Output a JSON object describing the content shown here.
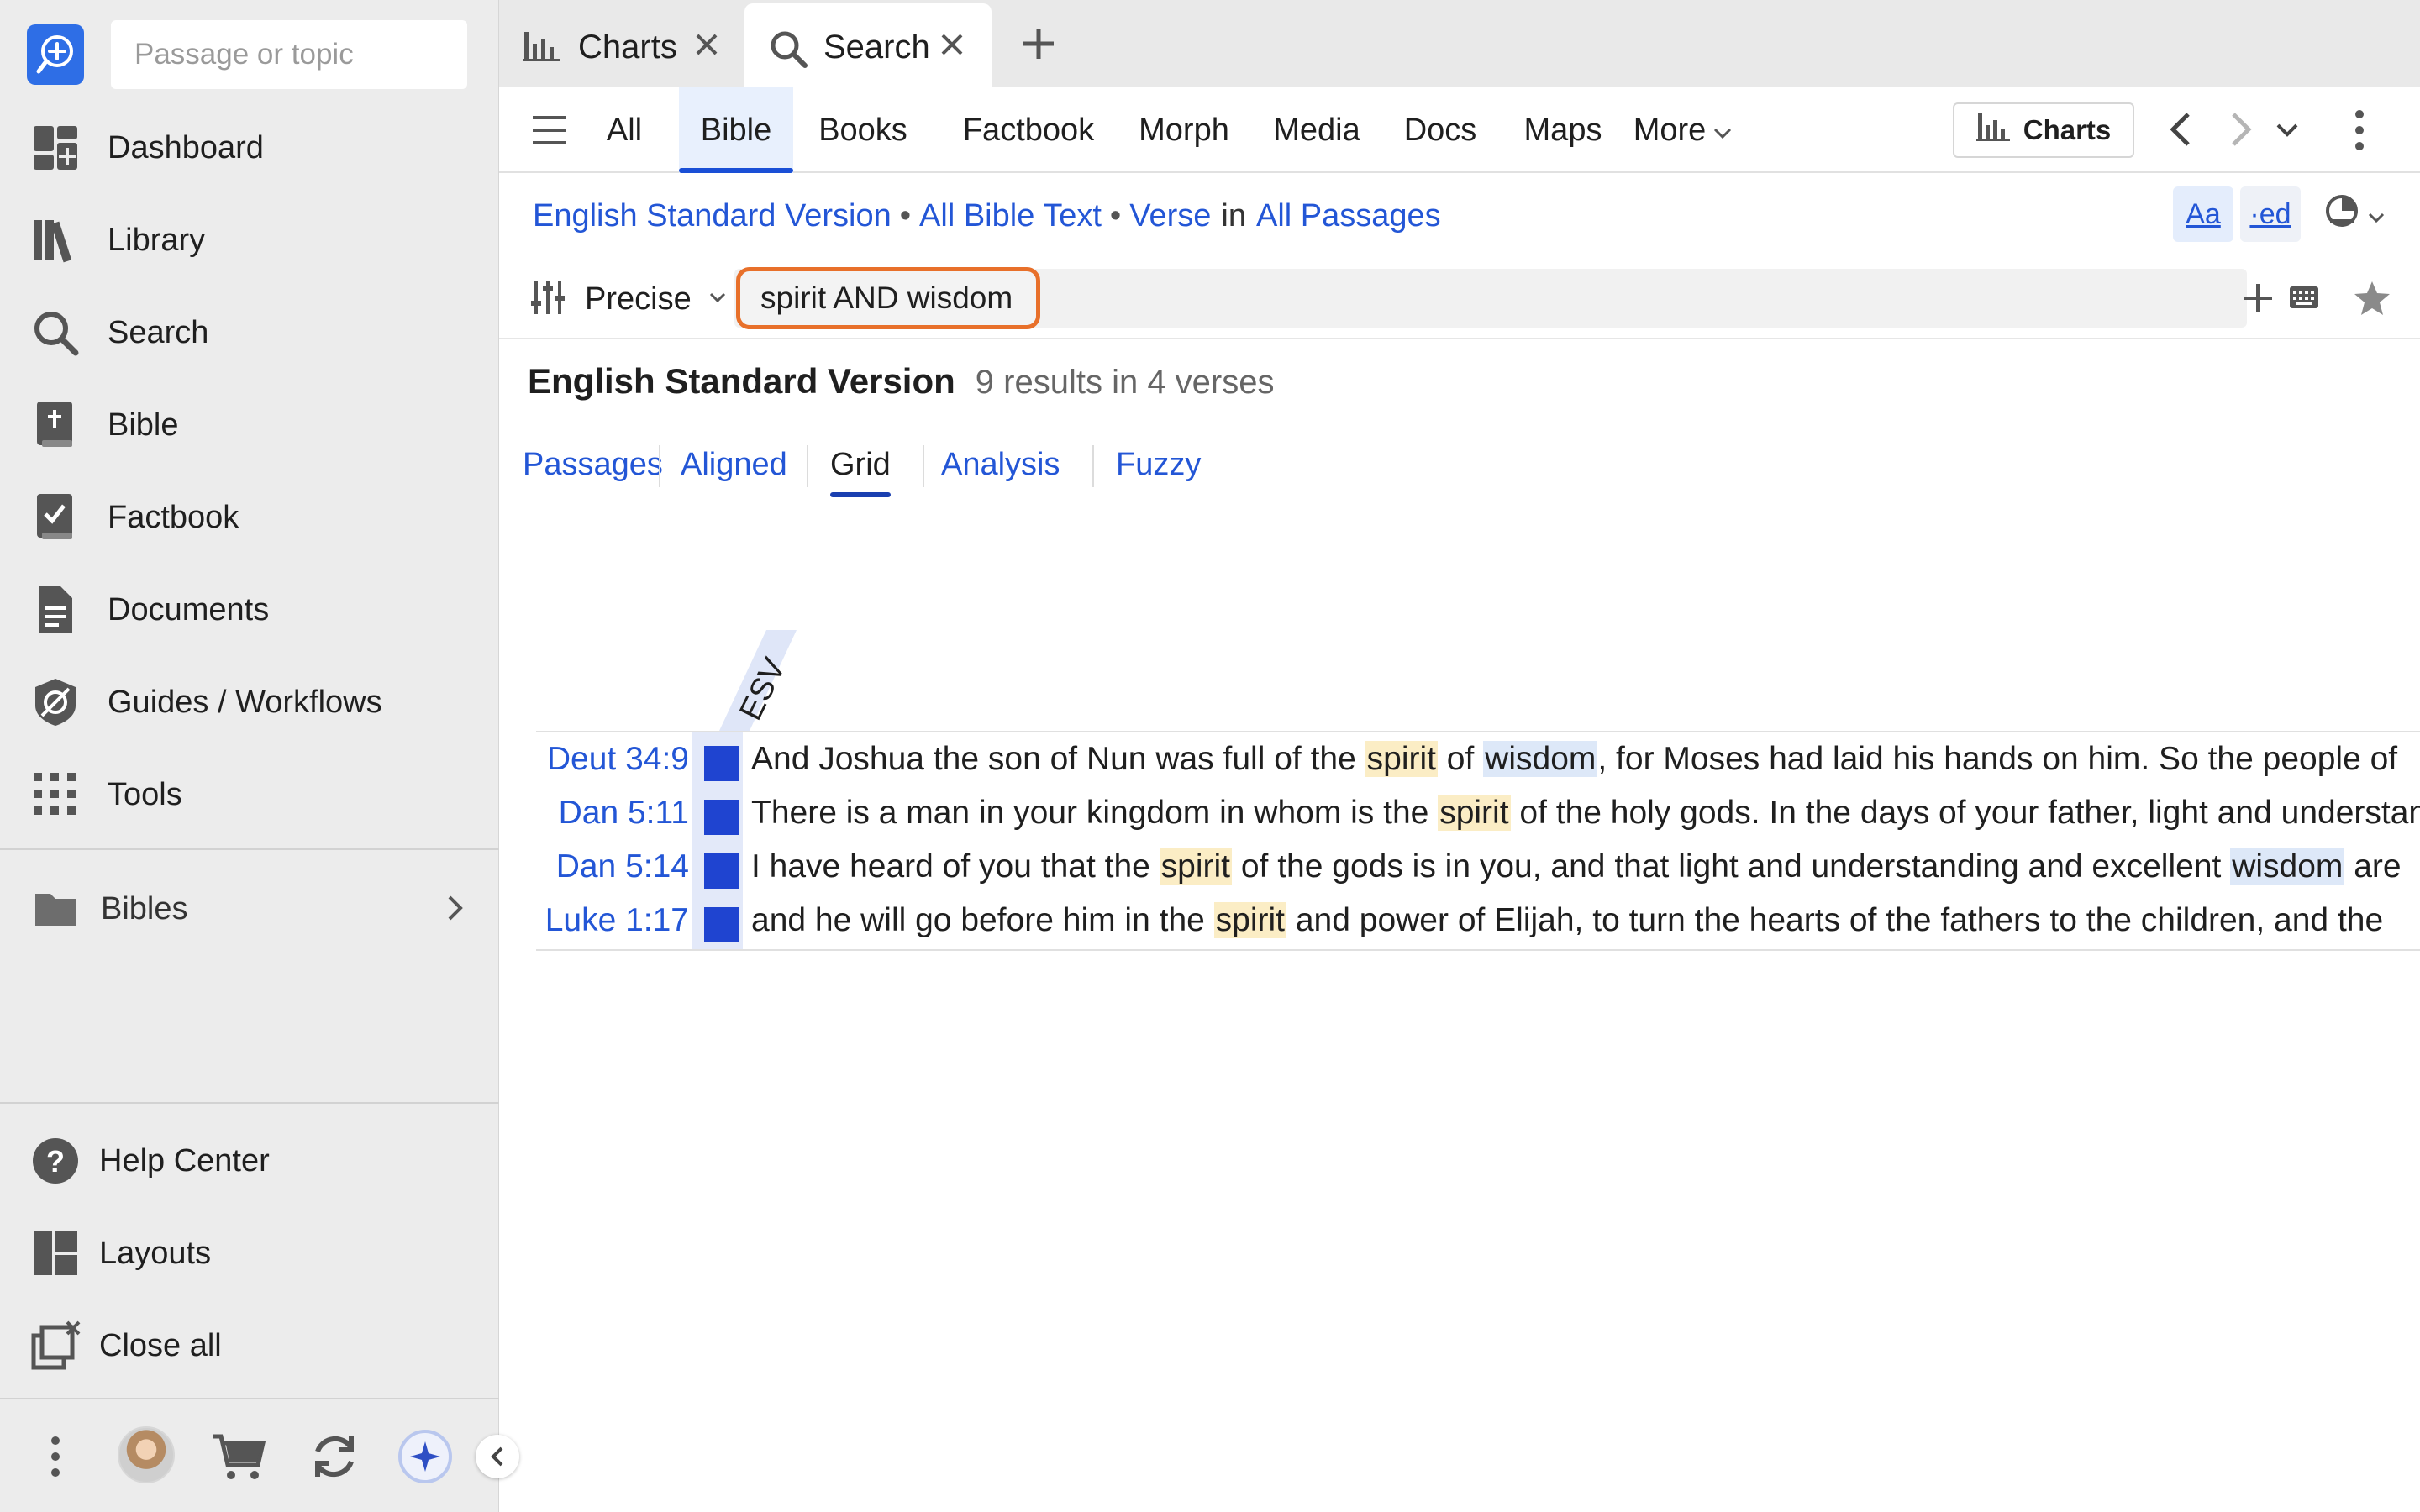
{
  "sidebar": {
    "passage_placeholder": "Passage or topic",
    "nav": [
      {
        "label": "Dashboard"
      },
      {
        "label": "Library"
      },
      {
        "label": "Search"
      },
      {
        "label": "Bible"
      },
      {
        "label": "Factbook"
      },
      {
        "label": "Documents"
      },
      {
        "label": "Guides / Workflows"
      },
      {
        "label": "Tools"
      }
    ],
    "bibles": {
      "label": "Bibles"
    },
    "footer_nav": [
      {
        "label": "Help Center"
      },
      {
        "label": "Layouts"
      },
      {
        "label": "Close all"
      }
    ]
  },
  "tabs": [
    {
      "label": "Charts",
      "icon": "bar-chart-icon"
    },
    {
      "label": "Search",
      "icon": "search-icon",
      "active": true
    }
  ],
  "toolbar": {
    "tabs": [
      "All",
      "Bible",
      "Books",
      "Factbook",
      "Morph",
      "Media",
      "Docs",
      "Maps",
      "More"
    ],
    "active_tab": "Bible",
    "charts_label": "Charts"
  },
  "breadcrumb": {
    "version": "English Standard Version",
    "scope": "All Bible Text",
    "unit": "Verse",
    "in": "in",
    "range": "All Passages"
  },
  "format_buttons": {
    "font": "Aa",
    "ed": "·ed"
  },
  "search": {
    "mode": "Precise",
    "query": "spirit AND wisdom"
  },
  "results": {
    "title": "English Standard Version",
    "count": "9 results in 4 verses"
  },
  "view_tabs": [
    "Passages",
    "Aligned",
    "Grid",
    "Analysis",
    "Fuzzy"
  ],
  "active_view": "Grid",
  "grid": {
    "column": "ESV",
    "cell_color": "#1f44d0",
    "rows": [
      {
        "ref": "Deut 34:9",
        "pre": "And Joshua the son of Nun was full of the ",
        "h1": "spirit",
        "mid": " of ",
        "h2": "wisdom",
        "post": ", for Moses had laid his hands on him. So the people of"
      },
      {
        "ref": "Dan 5:11",
        "pre": "There is a man in your kingdom in whom is the ",
        "h1": "spirit",
        "mid": " of the holy gods. In the days of your father, light and understanding",
        "h2": "",
        "post": ""
      },
      {
        "ref": "Dan 5:14",
        "pre": "I have heard of you that the ",
        "h1": "spirit",
        "mid": " of the gods is in you, and that light and understanding and excellent ",
        "h2": "wisdom",
        "post": " are"
      },
      {
        "ref": "Luke 1:17",
        "pre": "and he will go before him in the ",
        "h1": "spirit",
        "mid": " and power of Elijah, to turn the hearts of the fathers to the children, and the",
        "h2": "",
        "post": ""
      }
    ]
  },
  "colors": {
    "accent": "#2356d6",
    "highlight_spirit": "#fbedc5",
    "highlight_wisdom": "#dde8f8",
    "query_outline": "#e8702a"
  }
}
